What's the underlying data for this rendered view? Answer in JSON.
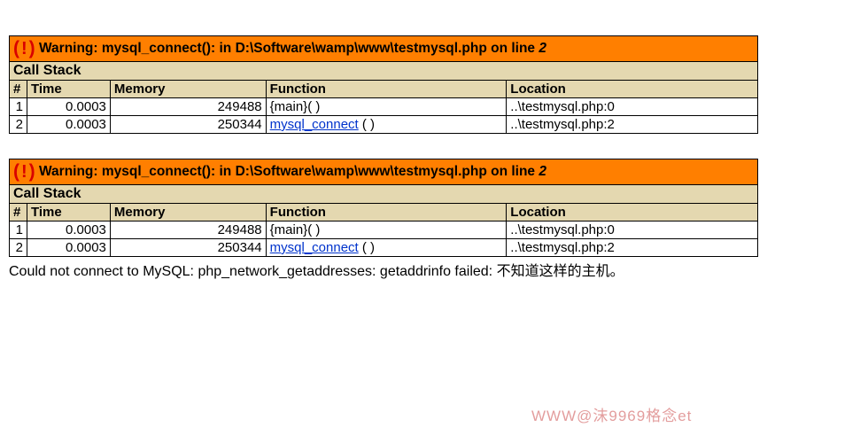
{
  "errors": [
    {
      "bang_open": "(",
      "bang_mark": "!",
      "bang_close": ")",
      "warning_label": "Warning: mysql_connect(): in D:\\Software\\wamp\\www\\testmysql.php on line ",
      "line": "2",
      "callstack_label": "Call Stack",
      "cols": {
        "num": "#",
        "time": "Time",
        "mem": "Memory",
        "fn": "Function",
        "loc": "Location"
      },
      "rows": [
        {
          "n": "1",
          "time": "0.0003",
          "mem": "249488",
          "fn": "{main}( )",
          "fn_link": false,
          "loc": "..\\testmysql.php:0"
        },
        {
          "n": "2",
          "time": "0.0003",
          "mem": "250344",
          "fn": "mysql_connect",
          "fn_suffix": " ( )",
          "fn_link": true,
          "loc": "..\\testmysql.php:2"
        }
      ]
    },
    {
      "bang_open": "(",
      "bang_mark": "!",
      "bang_close": ")",
      "warning_label": "Warning: mysql_connect(): in D:\\Software\\wamp\\www\\testmysql.php on line ",
      "line": "2",
      "callstack_label": "Call Stack",
      "cols": {
        "num": "#",
        "time": "Time",
        "mem": "Memory",
        "fn": "Function",
        "loc": "Location"
      },
      "rows": [
        {
          "n": "1",
          "time": "0.0003",
          "mem": "249488",
          "fn": "{main}( )",
          "fn_link": false,
          "loc": "..\\testmysql.php:0"
        },
        {
          "n": "2",
          "time": "0.0003",
          "mem": "250344",
          "fn": "mysql_connect",
          "fn_suffix": " ( )",
          "fn_link": true,
          "loc": "..\\testmysql.php:2"
        }
      ]
    }
  ],
  "footer": "Could not connect to MySQL: php_network_getaddresses: getaddrinfo failed: 不知道这样的主机。",
  "watermark": "WWW@沫9969格念et"
}
